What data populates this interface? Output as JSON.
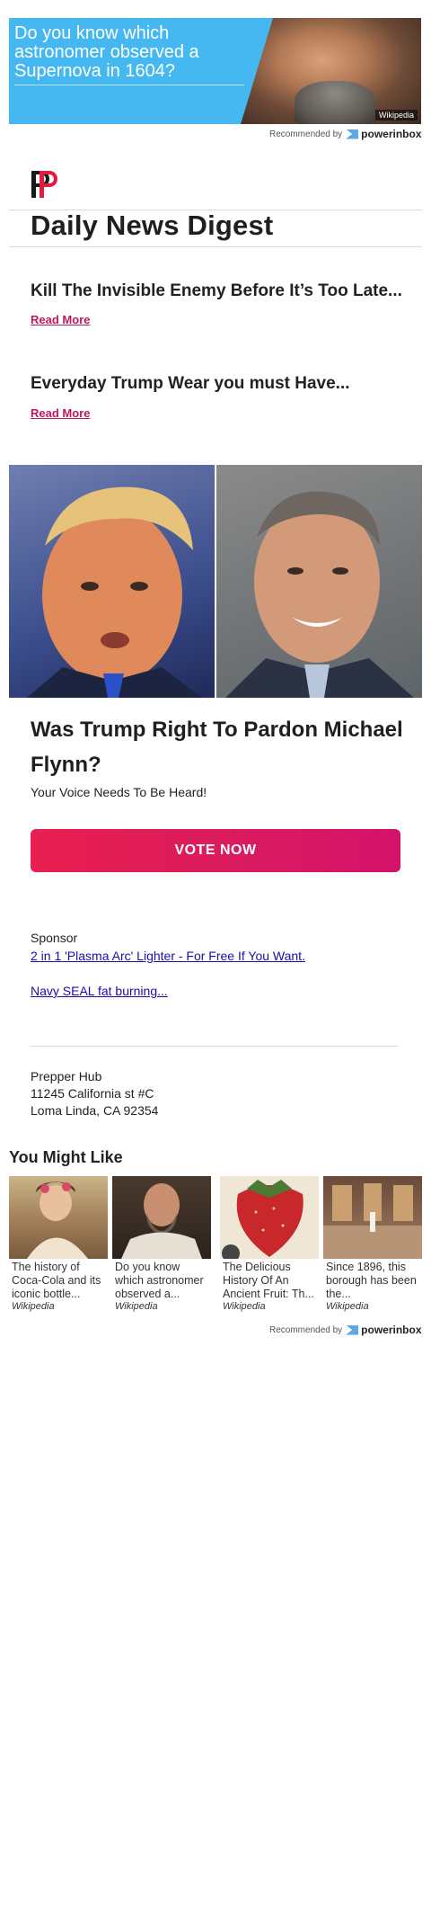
{
  "top_ad": {
    "headline": "Do you know which astronomer observed a Supernova in 1604?",
    "source": "Wikipedia",
    "recommended_by": "Recommended by",
    "brand": "powerinbox"
  },
  "newsletter": {
    "title": "Daily News Digest"
  },
  "articles": [
    {
      "headline": "Kill The Invisible Enemy Before It’s Too Late...",
      "link": "Read More"
    },
    {
      "headline": "Everyday Trump Wear you must Have...",
      "link": "Read More"
    }
  ],
  "poll": {
    "question": "Was Trump Right To Pardon Michael Flynn?",
    "subtitle": "Your Voice Needs To Be Heard!",
    "button": "VOTE NOW"
  },
  "sponsor": {
    "label": "Sponsor",
    "links": [
      "2 in 1 'Plasma Arc' Lighter - For Free If You Want.",
      "Navy SEAL fat burning..."
    ]
  },
  "address": {
    "line1": "Prepper Hub",
    "line2": "11245 California st #C",
    "line3": "Loma Linda, CA 92354"
  },
  "you_might_like": {
    "title": "You Might Like",
    "cards": [
      {
        "caption": "The history of Coca-Cola and its iconic bottle...",
        "source": "Wikipedia"
      },
      {
        "caption": "Do you know which astronomer observed a...",
        "source": "Wikipedia"
      },
      {
        "caption": "The Delicious History Of An Ancient Fruit: Th...",
        "source": "Wikipedia"
      },
      {
        "caption": "Since 1896, this borough has been the...",
        "source": "Wikipedia"
      }
    ],
    "recommended_by": "Recommended by",
    "brand": "powerinbox"
  },
  "colors": {
    "accent": "#d81b60",
    "ad_blue": "#45b8f2",
    "link": "#1a0dab"
  }
}
